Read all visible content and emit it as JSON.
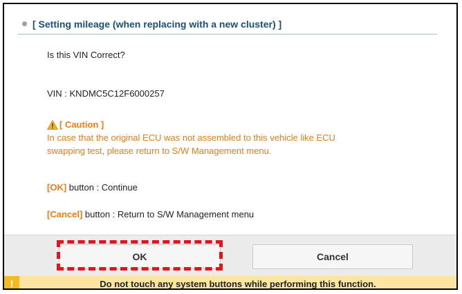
{
  "header": {
    "title": "[ Setting mileage (when replacing with a new cluster) ]"
  },
  "body": {
    "question": "Is this VIN Correct?",
    "vin_line": "VIN : KNDMC5C12F6000257",
    "caution_title": "[ Caution ]",
    "caution_line1": "In case that the original ECU was not assembled to this vehicle like ECU",
    "caution_line2": "swapping test, please return to S/W Management menu.",
    "ok_info_key": "[OK]",
    "ok_info_text": " button : Continue",
    "cancel_info_key": "[Cancel]",
    "cancel_info_text": " button : Return to S/W Management menu"
  },
  "buttons": {
    "ok_label": "OK",
    "cancel_label": "Cancel"
  },
  "footer": {
    "icon": "!",
    "message": "Do not touch any system buttons while performing this function."
  },
  "colors": {
    "caution": "#f07a13",
    "highlight": "#e0161f",
    "footer_bg": "#fbe6a0",
    "footer_icon_bg": "#f3b922",
    "header_text": "#1c4f74"
  },
  "icons": {
    "bullet": "bullet-dot-icon",
    "caution": "warning-triangle-icon",
    "footer": "exclamation-icon"
  }
}
